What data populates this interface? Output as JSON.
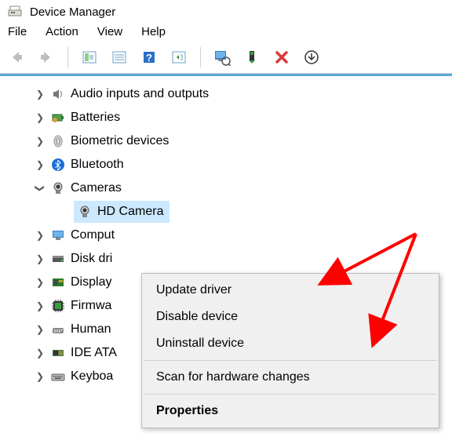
{
  "window": {
    "title": "Device Manager"
  },
  "menubar": [
    "File",
    "Action",
    "View",
    "Help"
  ],
  "toolbar": [
    {
      "name": "back-icon",
      "enabled": false
    },
    {
      "name": "forward-icon",
      "enabled": false
    },
    {
      "name": "show-hidden-icon",
      "enabled": true
    },
    {
      "name": "properties-panel-icon",
      "enabled": true
    },
    {
      "name": "help-icon",
      "enabled": true
    },
    {
      "name": "scan-hardware-icon",
      "enabled": true
    },
    {
      "name": "update-driver-icon",
      "enabled": true
    },
    {
      "name": "uninstall-device-icon",
      "enabled": true
    },
    {
      "name": "disable-device-icon",
      "enabled": true
    },
    {
      "name": "action-icon",
      "enabled": true
    }
  ],
  "tree": [
    {
      "label": "Audio inputs and outputs",
      "expanded": false,
      "icon": "speaker-icon"
    },
    {
      "label": "Batteries",
      "expanded": false,
      "icon": "battery-icon"
    },
    {
      "label": "Biometric devices",
      "expanded": false,
      "icon": "fingerprint-icon"
    },
    {
      "label": "Bluetooth",
      "expanded": false,
      "icon": "bluetooth-icon"
    },
    {
      "label": "Cameras",
      "expanded": true,
      "icon": "camera-icon",
      "children": [
        {
          "label": "HD Camera",
          "selected": true,
          "icon": "camera-icon"
        }
      ]
    },
    {
      "label": "Computer",
      "expanded": false,
      "icon": "monitor-icon",
      "truncated": "Comput"
    },
    {
      "label": "Disk drives",
      "expanded": false,
      "icon": "disk-icon",
      "truncated": "Disk dri"
    },
    {
      "label": "Display adapters",
      "expanded": false,
      "icon": "display-adapter-icon",
      "truncated": "Display"
    },
    {
      "label": "Firmware",
      "expanded": false,
      "icon": "firmware-icon",
      "truncated": "Firmwa"
    },
    {
      "label": "Human Interface Devices",
      "expanded": false,
      "icon": "hid-icon",
      "truncated": "Human"
    },
    {
      "label": "IDE ATA/ATAPI controllers",
      "expanded": false,
      "icon": "ide-icon",
      "truncated": "IDE ATA"
    },
    {
      "label": "Keyboards",
      "expanded": false,
      "icon": "keyboard-icon",
      "truncated": "Keyboa"
    }
  ],
  "context_menu": {
    "items": [
      {
        "label": "Update driver",
        "kind": "item"
      },
      {
        "label": "Disable device",
        "kind": "item"
      },
      {
        "label": "Uninstall device",
        "kind": "item"
      },
      {
        "kind": "sep"
      },
      {
        "label": "Scan for hardware changes",
        "kind": "item"
      },
      {
        "kind": "sep"
      },
      {
        "label": "Properties",
        "kind": "bold"
      }
    ]
  }
}
